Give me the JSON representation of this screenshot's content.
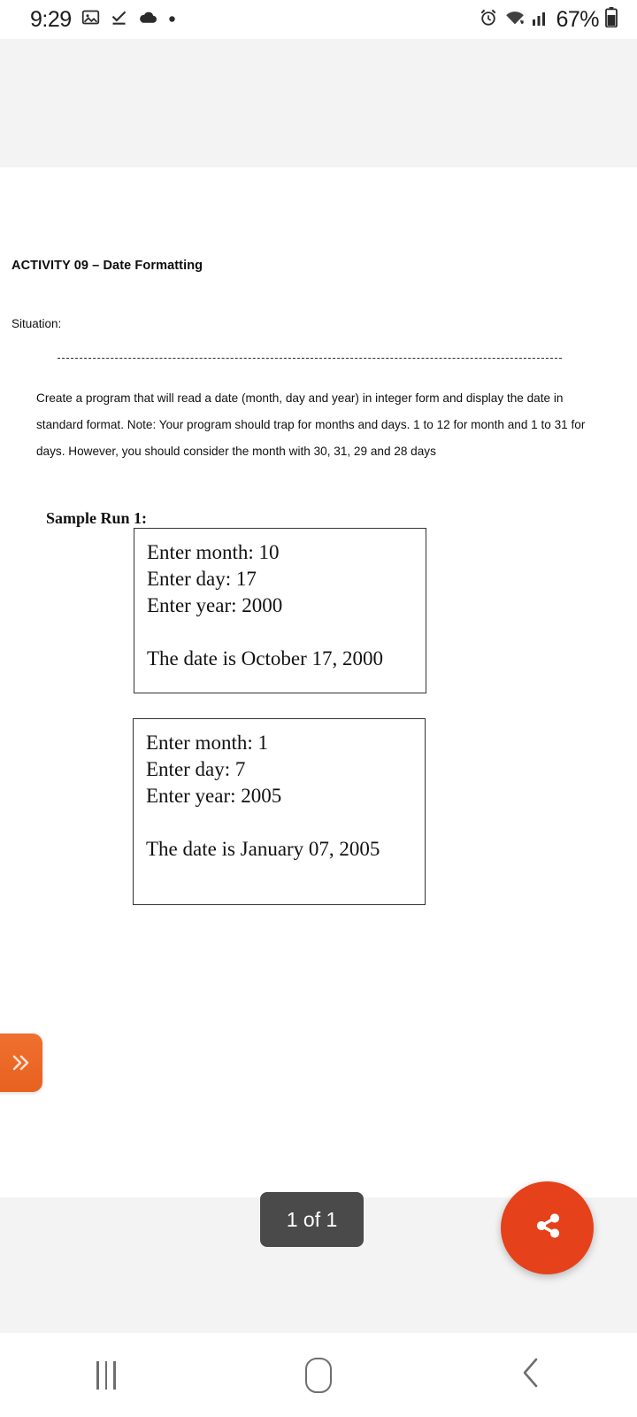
{
  "status_bar": {
    "clock": "9:29",
    "battery_percent": "67%",
    "icons": [
      "image-icon",
      "download-complete-icon",
      "cloud-icon",
      "dot-icon",
      "alarm-icon",
      "wifi-icon",
      "signal-icon",
      "battery-icon"
    ]
  },
  "document": {
    "title": "ACTIVITY 09 – Date Formatting",
    "situation_label": "Situation:",
    "brief": "Create a program that will read a date (month, day and year) in integer form and display the date in standard format. Note: Your program should trap for months and days. 1 to 12 for month and 1 to 31 for days. However, you should consider the month with 30, 31, 29 and 28 days",
    "sample_run_label": "Sample Run 1:",
    "run_boxes": [
      {
        "lines": [
          "Enter month: 10",
          "Enter day: 17",
          "Enter year: 2000"
        ],
        "result": "The date is October 17, 2000"
      },
      {
        "lines": [
          "Enter month: 1",
          "Enter day: 7",
          "Enter year: 2005"
        ],
        "result": "The date is January 07, 2005"
      }
    ]
  },
  "viewer": {
    "side_tab_icon": "double-chevron-right-icon",
    "page_indicator": "1 of 1",
    "share_icon": "share-icon",
    "accent_color": "#e5411a",
    "tab_color": "#ea6a27"
  },
  "nav_bar": {
    "recents_label": "recents-button",
    "home_label": "home-button",
    "back_label": "back-button"
  }
}
